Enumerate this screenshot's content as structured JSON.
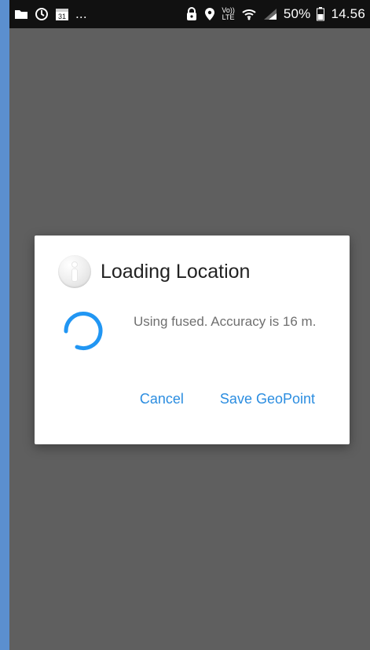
{
  "status_bar": {
    "left_icons": [
      "folder-icon",
      "sync-icon",
      "calendar-icon"
    ],
    "calendar_day": "31",
    "overflow": "...",
    "right_icons": [
      "lock-icon",
      "location-icon",
      "volte-icon",
      "wifi-icon",
      "signal-icon",
      "battery-icon"
    ],
    "volte_top": "Vo))",
    "volte_bottom": "LTE",
    "battery_percent": "50%",
    "time": "14.56"
  },
  "dialog": {
    "title": "Loading Location",
    "message": "Using fused. Accuracy is 16 m.",
    "cancel_label": "Cancel",
    "save_label": "Save GeoPoint"
  },
  "colors": {
    "accent": "#2b8de0",
    "spinner": "#2196f3",
    "overlay": "#5f5f5f",
    "status_bar": "#111111"
  }
}
